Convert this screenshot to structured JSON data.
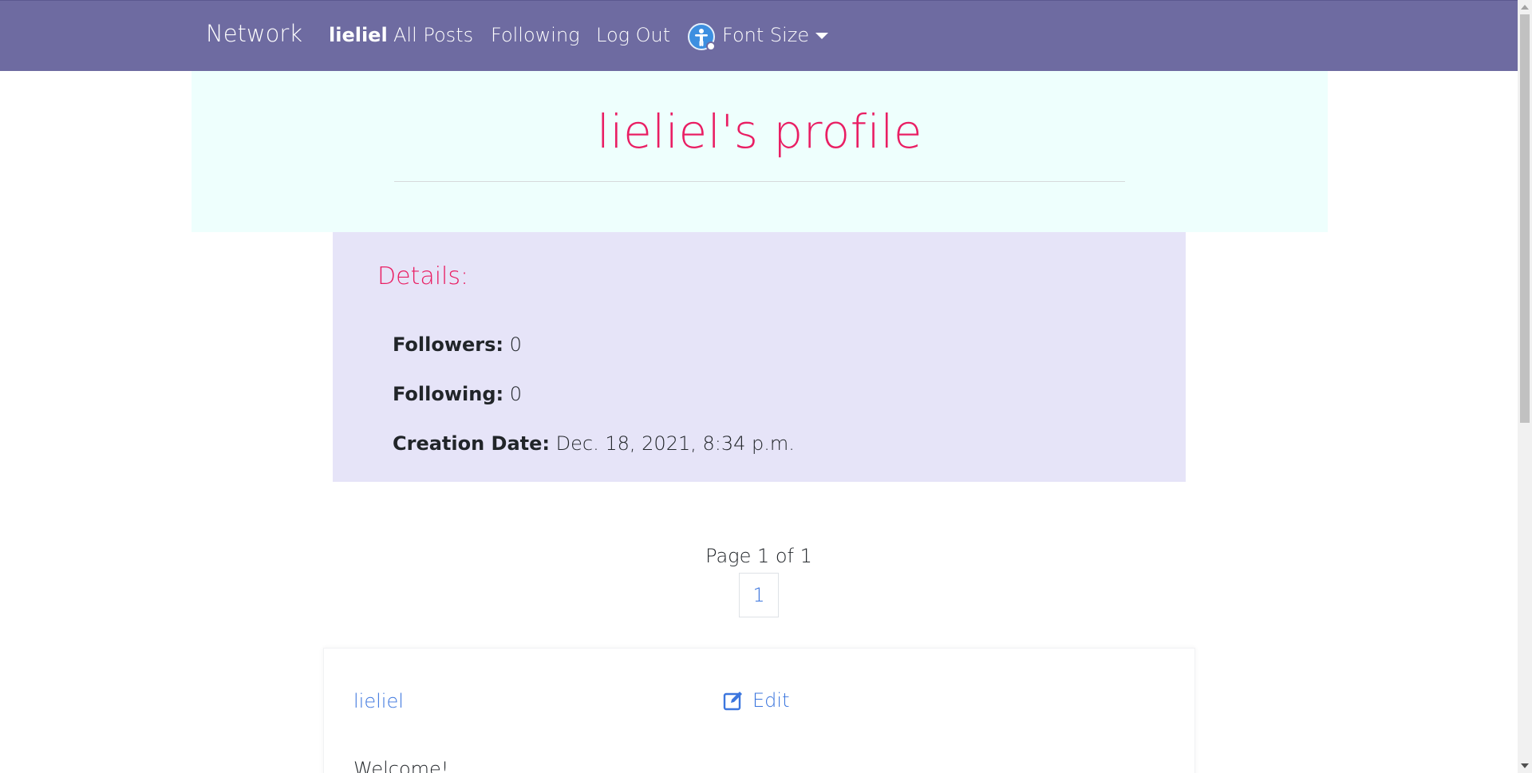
{
  "navbar": {
    "brand": "Network",
    "links": {
      "username": "lieliel",
      "all_posts": "All Posts",
      "following": "Following",
      "logout": "Log Out",
      "font_size": "Font Size"
    },
    "accessibility_icon": "accessibility-icon",
    "colors": {
      "background": "#6e6ba1",
      "text": "#ffffff"
    }
  },
  "hero": {
    "title": "lieliel's profile",
    "colors": {
      "background": "#eefffd",
      "title": "#e91e63"
    }
  },
  "details": {
    "heading": "Details:",
    "followers_label": "Followers:",
    "followers_value": "0",
    "following_label": "Following:",
    "following_value": "0",
    "creation_label": "Creation Date:",
    "creation_value": "Dec. 18, 2021, 8:34 p.m.",
    "colors": {
      "background": "#e6e4f8",
      "heading": "#e91e63"
    }
  },
  "pagination": {
    "info": "Page 1 of 1",
    "current_page": "1"
  },
  "post": {
    "author": "lieliel",
    "edit_label": "Edit",
    "edit_icon": "edit-icon",
    "body": "Welcome!",
    "colors": {
      "link": "#3c76de"
    }
  }
}
